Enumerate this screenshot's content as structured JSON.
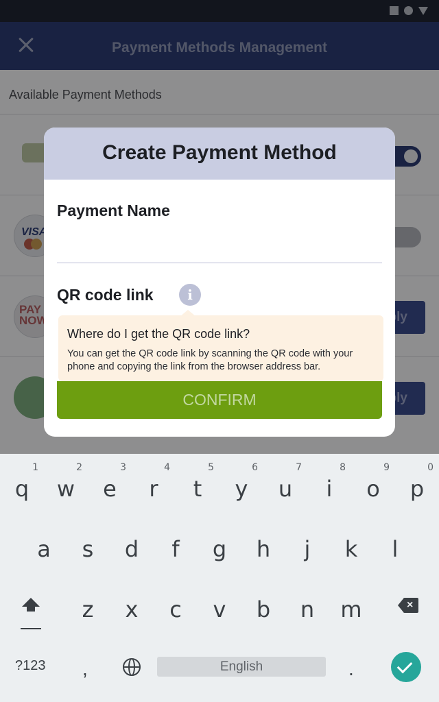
{
  "header": {
    "title": "Payment Methods Management",
    "close_icon": "close-icon"
  },
  "content": {
    "section_title": "Available Payment Methods",
    "methods": [
      {
        "logo_text": "CASH",
        "control": "toggle-on"
      },
      {
        "logo_text": "VISA",
        "control": "toggle-off"
      },
      {
        "logo_text": "PAY NOW",
        "control": "apply-button",
        "button_label": "ply"
      },
      {
        "logo_text": "WeChat",
        "control": "apply-button",
        "button_label": "ply"
      }
    ]
  },
  "dialog": {
    "title": "Create Payment Method",
    "payment_name_label": "Payment Name",
    "payment_name_value": "",
    "qr_label": "QR code link",
    "info_icon": "info-icon",
    "tooltip_title": "Where do I get the QR code link?",
    "tooltip_body": "You can get the QR code link by scanning the QR code with your phone and copying the link from the browser address bar.",
    "confirm_label": "CONFIRM"
  },
  "keyboard": {
    "row1": [
      {
        "key": "q",
        "num": "1"
      },
      {
        "key": "w",
        "num": "2"
      },
      {
        "key": "e",
        "num": "3"
      },
      {
        "key": "r",
        "num": "4"
      },
      {
        "key": "t",
        "num": "5"
      },
      {
        "key": "y",
        "num": "6"
      },
      {
        "key": "u",
        "num": "7"
      },
      {
        "key": "i",
        "num": "8"
      },
      {
        "key": "o",
        "num": "9"
      },
      {
        "key": "p",
        "num": "0"
      }
    ],
    "row2": [
      "a",
      "s",
      "d",
      "f",
      "g",
      "h",
      "j",
      "k",
      "l"
    ],
    "row3": [
      "z",
      "x",
      "c",
      "v",
      "b",
      "n",
      "m"
    ],
    "symbols_label": "?123",
    "comma_label": ",",
    "space_label": "English",
    "period_label": "."
  }
}
